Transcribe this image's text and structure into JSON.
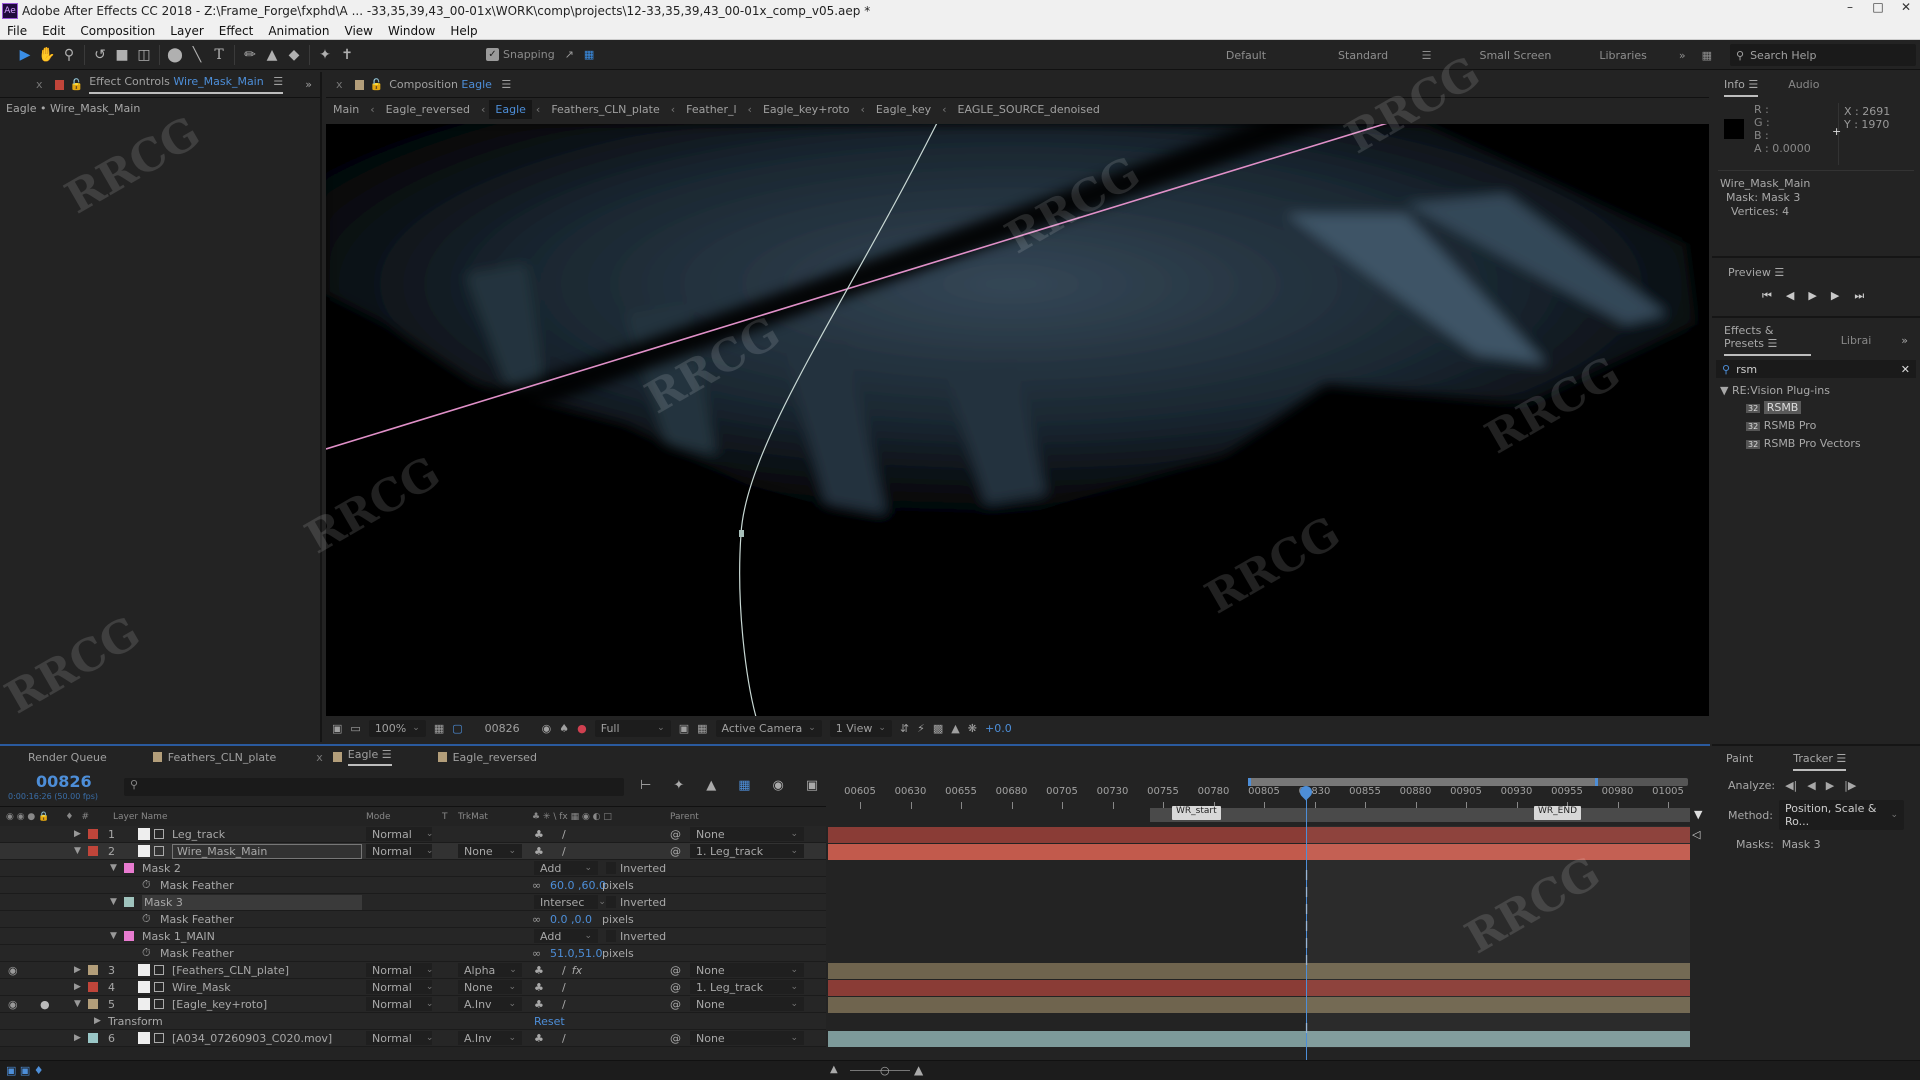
{
  "window": {
    "title": "Adobe After Effects CC 2018 - Z:\\Frame_Forge\\fxphd\\A ... -33,35,39,43_00-01x\\WORK\\comp\\projects\\12-33,35,39,43_00-01x_comp_v05.aep *",
    "app_icon": "Ae"
  },
  "menu": [
    "File",
    "Edit",
    "Composition",
    "Layer",
    "Effect",
    "Animation",
    "View",
    "Window",
    "Help"
  ],
  "toolbar": {
    "tools": [
      "selection-tool",
      "hand-tool",
      "zoom-tool",
      "rotate-tool",
      "camera-tool",
      "pan-behind-tool",
      "ellipse-tool",
      "pen-tool",
      "type-tool",
      "brush-tool",
      "clone-stamp-tool",
      "eraser-tool",
      "roto-brush-tool",
      "puppet-pin-tool"
    ],
    "snapping_label": "Snapping",
    "snapping_checked": true,
    "workspaces": [
      "Default",
      "Standard",
      "Small Screen",
      "Libraries"
    ],
    "active_workspace": "Standard",
    "search_placeholder": "Search Help"
  },
  "effect_controls": {
    "tab_label": "Effect Controls",
    "layer_name": "Wire_Mask_Main",
    "subtitle": "Eagle • Wire_Mask_Main"
  },
  "composition": {
    "tab_label": "Composition",
    "comp_name": "Eagle",
    "breadcrumbs": [
      "Main",
      "Eagle_reversed",
      "Eagle",
      "Feathers_CLN_plate",
      "Feather_l",
      "Eagle_key+roto",
      "Eagle_key",
      "EAGLE_SOURCE_denoised"
    ],
    "current_crumb": "Eagle",
    "footer": {
      "zoom": "100%",
      "frame": "00826",
      "resolution": "Full",
      "camera": "Active Camera",
      "views": "1 View",
      "exposure": "+0.0"
    }
  },
  "info": {
    "tabs": [
      "Info",
      "Audio"
    ],
    "r": "R :",
    "g": "G :",
    "b": "B :",
    "a": "A :  0.0000",
    "x": "X : 2691",
    "y": "Y : 1970",
    "layer": "Wire_Mask_Main",
    "mask": "Mask: Mask 3",
    "vertices": "Vertices: 4"
  },
  "preview": {
    "title": "Preview"
  },
  "effects_presets": {
    "tab": "Effects & Presets",
    "tab2": "Librai",
    "search_value": "rsm",
    "group": "RE:Vision Plug-ins",
    "items": [
      "RSMB",
      "RSMB Pro",
      "RSMB Pro Vectors"
    ],
    "selected": "RSMB"
  },
  "tracker": {
    "tabs": [
      "Paint",
      "Tracker"
    ],
    "analyze_label": "Analyze:",
    "method_label": "Method:",
    "method_value": "Position, Scale & Ro...",
    "masks_label": "Masks:",
    "masks_value": "Mask 3"
  },
  "timeline": {
    "tabs": [
      "Render Queue",
      "Feathers_CLN_plate",
      "Eagle",
      "Eagle_reversed"
    ],
    "active_tab": "Eagle",
    "timecode": "00826",
    "timecode_sub": "0:00:16:26 (50.00 fps)",
    "columns": {
      "layer_name": "Layer Name",
      "mode": "Mode",
      "t": "T",
      "trkmat": "TrkMat",
      "parent": "Parent"
    },
    "layers": [
      {
        "num": "1",
        "name": "Leg_track",
        "color": "#c0453a",
        "mode": "Normal",
        "trkmat": "",
        "parent": "None",
        "expanded": false,
        "visible": false
      },
      {
        "num": "2",
        "name": "Wire_Mask_Main",
        "color": "#c0453a",
        "mode": "Normal",
        "trkmat": "None",
        "parent": "1. Leg_track",
        "expanded": true,
        "visible": false,
        "selected": true
      },
      {
        "num": "3",
        "name": "[Feathers_CLN_plate]",
        "color": "#b39e7a",
        "mode": "Normal",
        "trkmat": "Alpha",
        "parent": "None",
        "expanded": false,
        "visible": true,
        "fx": true
      },
      {
        "num": "4",
        "name": "Wire_Mask",
        "color": "#c0453a",
        "mode": "Normal",
        "trkmat": "None",
        "parent": "1. Leg_track",
        "expanded": false,
        "visible": false
      },
      {
        "num": "5",
        "name": "[Eagle_key+roto]",
        "color": "#b39e7a",
        "mode": "Normal",
        "trkmat": "A.Inv",
        "parent": "None",
        "expanded": true,
        "visible": true,
        "solo": true
      },
      {
        "num": "6",
        "name": "[A034_07260903_C020.mov]",
        "color": "#9ac7c7",
        "mode": "Normal",
        "trkmat": "A.Inv",
        "parent": "None",
        "expanded": false,
        "visible": false
      }
    ],
    "masks": [
      {
        "name": "Mask 2",
        "color": "#e87bd0",
        "mode": "Add",
        "inverted": "Inverted",
        "feather_label": "Mask Feather",
        "feather": "60.0 ,60.0",
        "unit": "pixels"
      },
      {
        "name": "Mask 3",
        "color": "#9fc3bd",
        "mode": "Intersec",
        "inverted": "Inverted",
        "feather_label": "Mask Feather",
        "feather": "0.0 ,0.0",
        "unit": "pixels",
        "selected": true
      },
      {
        "name": "Mask 1_MAIN",
        "color": "#e87bd0",
        "mode": "Add",
        "inverted": "Inverted",
        "feather_label": "Mask Feather",
        "feather": "51.0,51.0",
        "unit": "pixels"
      }
    ],
    "transform_label": "Transform",
    "reset_label": "Reset",
    "ruler": [
      "00605",
      "00630",
      "00655",
      "00680",
      "00705",
      "00730",
      "00755",
      "00780",
      "00805",
      "00830",
      "00855",
      "00880",
      "00905",
      "00930",
      "00955",
      "00980",
      "01005"
    ],
    "markers": [
      "WR_start",
      "WR_END"
    ]
  }
}
